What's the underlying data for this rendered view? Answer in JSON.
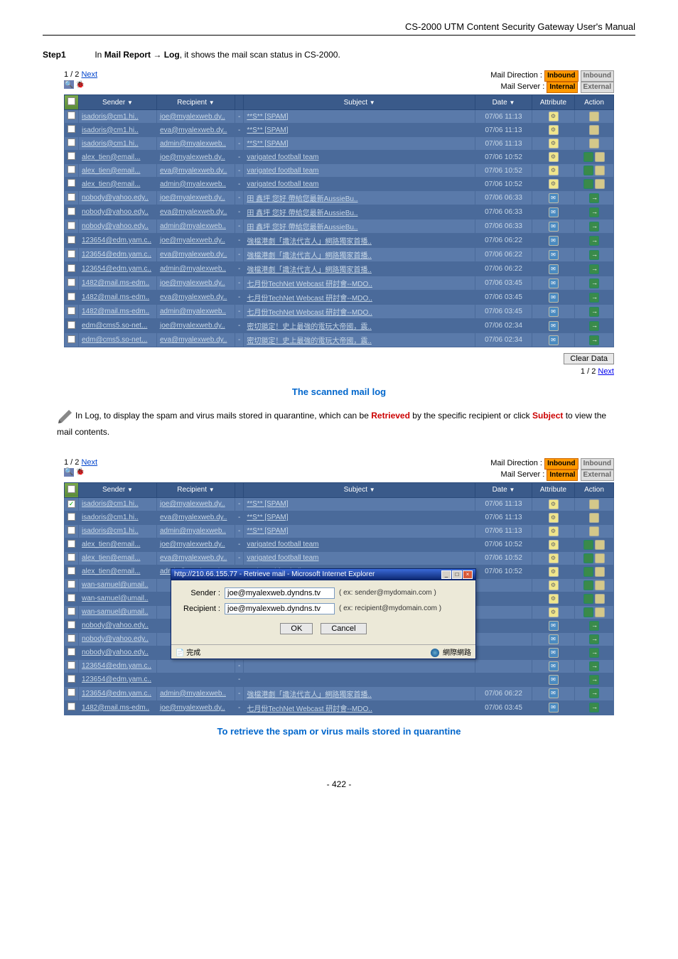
{
  "doc_header": "CS-2000 UTM Content Security Gateway User's Manual",
  "step": {
    "label": "Step1",
    "prefix": "In ",
    "b1": "Mail Report",
    "arrow": " → ",
    "b2": "Log",
    "suffix": ", it shows the mail scan status in CS-2000."
  },
  "nav": {
    "page": "1 / 2",
    "next": "Next"
  },
  "labels": {
    "mail_direction": "Mail Direction :",
    "mail_server": "Mail Server :",
    "inbound": "Inbound",
    "internal": "Internal",
    "external": "External"
  },
  "headers": {
    "sender": "Sender",
    "recipient": "Recipient",
    "subject": "Subject",
    "date": "Date",
    "attribute": "Attribute",
    "action": "Action"
  },
  "rows1": [
    {
      "sender": "isadoris@cm1.hi..",
      "recipient": "joe@myalexweb.dy..",
      "subject": "**S** [SPAM]",
      "date": "07/06 11:13",
      "attr": "spam",
      "actions": [
        "trash"
      ]
    },
    {
      "sender": "isadoris@cm1.hi..",
      "recipient": "eva@myalexweb.dy..",
      "subject": "**S** [SPAM]",
      "date": "07/06 11:13",
      "attr": "spam",
      "actions": [
        "trash"
      ]
    },
    {
      "sender": "isadoris@cm1.hi..",
      "recipient": "admin@myalexweb..",
      "subject": "**S** [SPAM]",
      "date": "07/06 11:13",
      "attr": "spam",
      "actions": [
        "trash"
      ]
    },
    {
      "sender": "alex_tien@email...",
      "recipient": "joe@myalexweb.dy..",
      "subject": "varigated football team",
      "date": "07/06 10:52",
      "attr": "spam",
      "actions": [
        "retrieve",
        "trash"
      ]
    },
    {
      "sender": "alex_tien@email...",
      "recipient": "eva@myalexweb.dy..",
      "subject": "varigated football team",
      "date": "07/06 10:52",
      "attr": "spam",
      "actions": [
        "retrieve",
        "trash"
      ]
    },
    {
      "sender": "alex_tien@email...",
      "recipient": "admin@myalexweb..",
      "subject": "varigated football team",
      "date": "07/06 10:52",
      "attr": "spam",
      "actions": [
        "retrieve",
        "trash"
      ]
    },
    {
      "sender": "nobody@yahoo.edy..",
      "recipient": "joe@myalexweb.dy..",
      "subject": "田 鑫坪 您好 帶給您最新AussieBu..",
      "date": "07/06 06:33",
      "attr": "blue",
      "actions": [
        "arrow"
      ]
    },
    {
      "sender": "nobody@yahoo.edy..",
      "recipient": "eva@myalexweb.dy..",
      "subject": "田 鑫坪 您好 帶給您最新AussieBu..",
      "date": "07/06 06:33",
      "attr": "blue",
      "actions": [
        "arrow"
      ]
    },
    {
      "sender": "nobody@yahoo.edy..",
      "recipient": "admin@myalexweb..",
      "subject": "田 鑫坪 您好 帶給您最新AussieBu..",
      "date": "07/06 06:33",
      "attr": "blue",
      "actions": [
        "arrow"
      ]
    },
    {
      "sender": "123654@edm.yam.c..",
      "recipient": "joe@myalexweb.dy..",
      "subject": "強檔港劇「識法代言人」網路獨家首播..",
      "date": "07/06 06:22",
      "attr": "blue",
      "actions": [
        "arrow"
      ]
    },
    {
      "sender": "123654@edm.yam.c..",
      "recipient": "eva@myalexweb.dy..",
      "subject": "強檔港劇「識法代言人」網路獨家首播..",
      "date": "07/06 06:22",
      "attr": "blue",
      "actions": [
        "arrow"
      ]
    },
    {
      "sender": "123654@edm.yam.c..",
      "recipient": "admin@myalexweb..",
      "subject": "強檔港劇「識法代言人」網路獨家首播..",
      "date": "07/06 06:22",
      "attr": "blue",
      "actions": [
        "arrow"
      ]
    },
    {
      "sender": "1482@mail.ms-edm..",
      "recipient": "joe@myalexweb.dy..",
      "subject": "七月份TechNet Webcast 研討會--MDO..",
      "date": "07/06 03:45",
      "attr": "blue",
      "actions": [
        "arrow"
      ]
    },
    {
      "sender": "1482@mail.ms-edm..",
      "recipient": "eva@myalexweb.dy..",
      "subject": "七月份TechNet Webcast 研討會--MDO..",
      "date": "07/06 03:45",
      "attr": "blue",
      "actions": [
        "arrow"
      ]
    },
    {
      "sender": "1482@mail.ms-edm..",
      "recipient": "admin@myalexweb..",
      "subject": "七月份TechNet Webcast 研討會--MDO..",
      "date": "07/06 03:45",
      "attr": "blue",
      "actions": [
        "arrow"
      ]
    },
    {
      "sender": "edm@cms5.so-net...",
      "recipient": "joe@myalexweb.dy..",
      "subject": "密切鎖定！史上最強的電玩大帝國，震..",
      "date": "07/06 02:34",
      "attr": "blue",
      "actions": [
        "arrow"
      ]
    },
    {
      "sender": "edm@cms5.so-net...",
      "recipient": "eva@myalexweb.dy..",
      "subject": "密切鎖定！史上最強的電玩大帝國，震..",
      "date": "07/06 02:34",
      "attr": "blue",
      "actions": [
        "arrow"
      ]
    }
  ],
  "clear_btn": "Clear Data",
  "caption1": "The scanned mail log",
  "note": {
    "p1a": "In Log, to display the spam and virus mails stored in quarantine, which can be ",
    "p1b": "Retrieved",
    "p1c": " by the specific recipient or click ",
    "p1d": "Subject",
    "p1e": " to view the mail contents."
  },
  "rows2": [
    {
      "chk": true,
      "sender": "isadoris@cm1.hi..",
      "recipient": "joe@myalexweb.dy..",
      "subject": "**S** [SPAM]",
      "date": "07/06 11:13",
      "attr": "spam",
      "actions": [
        "trash"
      ]
    },
    {
      "chk": false,
      "sender": "isadoris@cm1.hi..",
      "recipient": "eva@myalexweb.dy..",
      "subject": "**S** [SPAM]",
      "date": "07/06 11:13",
      "attr": "spam",
      "actions": [
        "trash"
      ]
    },
    {
      "chk": false,
      "sender": "isadoris@cm1.hi..",
      "recipient": "admin@myalexweb..",
      "subject": "**S** [SPAM]",
      "date": "07/06 11:13",
      "attr": "spam",
      "actions": [
        "trash"
      ]
    },
    {
      "chk": false,
      "sender": "alex_tien@email...",
      "recipient": "joe@myalexweb.dy..",
      "subject": "varigated football team",
      "date": "07/06 10:52",
      "attr": "spam",
      "actions": [
        "retrieve",
        "trash"
      ]
    },
    {
      "chk": false,
      "sender": "alex_tien@email...",
      "recipient": "eva@myalexweb.dy..",
      "subject": "varigated football team",
      "date": "07/06 10:52",
      "attr": "spam",
      "actions": [
        "retrieve",
        "trash"
      ]
    },
    {
      "chk": false,
      "sender": "alex_tien@email...",
      "recipient": "admin@myalexweb..",
      "subject": "varigated football team",
      "date": "07/06 10:52",
      "attr": "spam",
      "actions": [
        "retrieve",
        "trash"
      ]
    },
    {
      "chk": false,
      "sender": "wan-samuel@umail..",
      "recipient": "",
      "subject": "",
      "date": "",
      "attr": "spam",
      "actions": [
        "retrieve",
        "trash"
      ],
      "popup": true
    },
    {
      "chk": false,
      "sender": "wan-samuel@umail..",
      "recipient": "",
      "subject": "",
      "date": "",
      "attr": "spam",
      "actions": [
        "retrieve",
        "trash"
      ],
      "popup": true
    },
    {
      "chk": false,
      "sender": "wan-samuel@umail..",
      "recipient": "",
      "subject": "",
      "date": "",
      "attr": "spam",
      "actions": [
        "retrieve",
        "trash"
      ],
      "popup": true
    },
    {
      "chk": false,
      "sender": "nobody@yahoo.edy..",
      "recipient": "",
      "subject": "",
      "date": "",
      "attr": "blue",
      "actions": [
        "arrow"
      ],
      "popup": true
    },
    {
      "chk": false,
      "sender": "nobody@yahoo.edy..",
      "recipient": "",
      "subject": "",
      "date": "",
      "attr": "blue",
      "actions": [
        "arrow"
      ],
      "popup": true
    },
    {
      "chk": false,
      "sender": "nobody@yahoo.edy..",
      "recipient": "",
      "subject": "",
      "date": "",
      "attr": "blue",
      "actions": [
        "arrow"
      ],
      "popup": true
    },
    {
      "chk": false,
      "sender": "123654@edm.yam.c..",
      "recipient": "",
      "subject": "",
      "date": "",
      "attr": "blue",
      "actions": [
        "arrow"
      ],
      "popup": true
    },
    {
      "chk": false,
      "sender": "123654@edm.yam.c..",
      "recipient": "",
      "subject": "",
      "date": "",
      "attr": "blue",
      "actions": [
        "arrow"
      ],
      "popup": true
    },
    {
      "chk": false,
      "sender": "123654@edm.yam.c..",
      "recipient": "admin@myalexweb..",
      "subject": "強檔港劇「識法代言人」網路獨家首播..",
      "date": "07/06 06:22",
      "attr": "blue",
      "actions": [
        "arrow"
      ]
    },
    {
      "chk": false,
      "sender": "1482@mail.ms-edm..",
      "recipient": "joe@myalexweb.dy..",
      "subject": "七月份TechNet Webcast 研討會--MDO..",
      "date": "07/06 03:45",
      "attr": "blue",
      "actions": [
        "arrow"
      ]
    }
  ],
  "popup": {
    "title": "http://210.66.155.77 - Retrieve mail - Microsoft Internet Explorer",
    "sender_label": "Sender :",
    "recipient_label": "Recipient :",
    "sender_value": "joe@myalexweb.dyndns.tv",
    "recipient_value": "joe@myalexweb.dyndns.tv",
    "sender_hint": "( ex: sender@mydomain.com )",
    "recipient_hint": "( ex: recipient@mydomain.com )",
    "ok": "OK",
    "cancel": "Cancel",
    "done": "完成",
    "zone": "網際網路"
  },
  "caption2": "To retrieve the spam or virus mails stored in quarantine",
  "footer": "- 422 -"
}
